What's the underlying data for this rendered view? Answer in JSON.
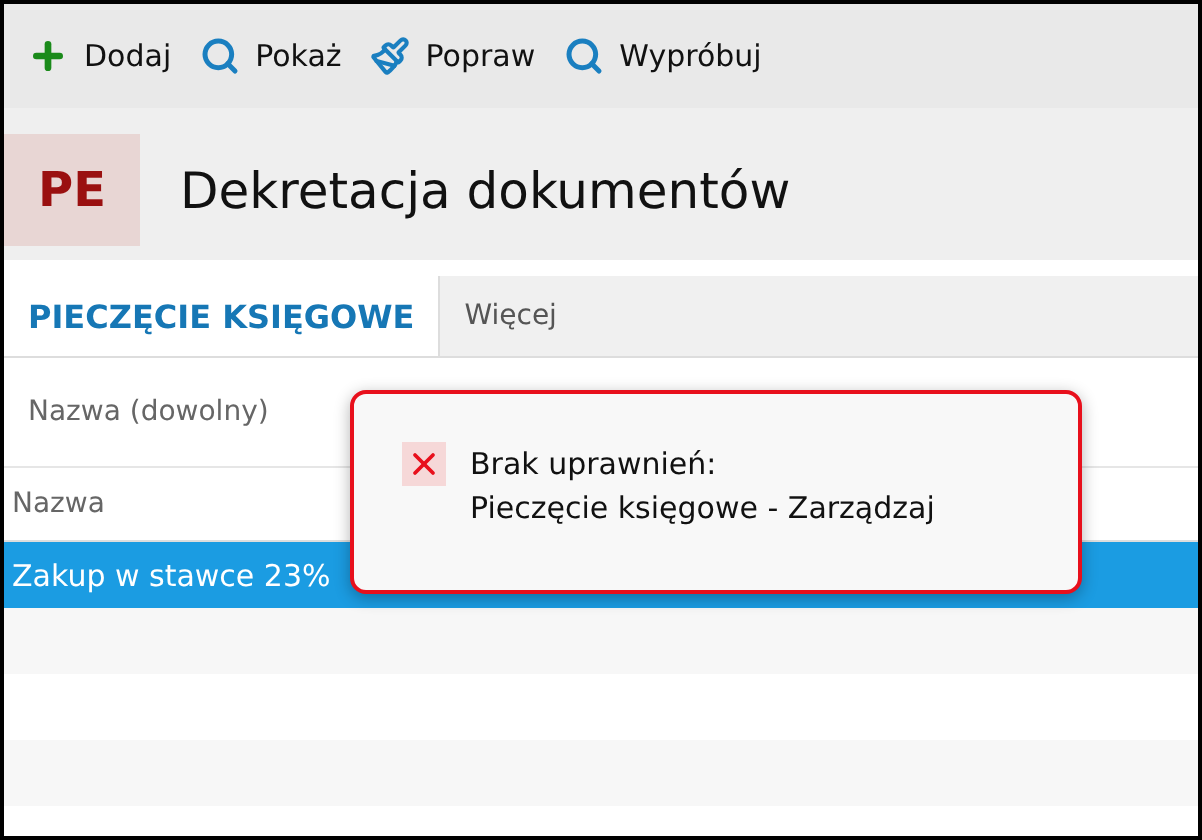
{
  "toolbar": [
    {
      "kind": "add",
      "label": "Dodaj"
    },
    {
      "kind": "search",
      "label": "Pokaż"
    },
    {
      "kind": "brush",
      "label": "Popraw"
    },
    {
      "kind": "search",
      "label": "Wypróbuj"
    }
  ],
  "header": {
    "badge": "PE",
    "title": "Dekretacja dokumentów"
  },
  "tabs": [
    {
      "label": "PIECZĘCIE KSIĘGOWE",
      "selected": true
    },
    {
      "label": "Więcej",
      "selected": false
    }
  ],
  "filter": {
    "label": "Nazwa (dowolny)"
  },
  "table": {
    "columns": [
      "Nazwa"
    ],
    "rows": [
      {
        "cells": [
          "Zakup w stawce 23%"
        ],
        "selected": true
      }
    ]
  },
  "error_popup": {
    "lines": [
      "Brak uprawnień:",
      "Pieczęcie księgowe - Zarządzaj"
    ]
  }
}
